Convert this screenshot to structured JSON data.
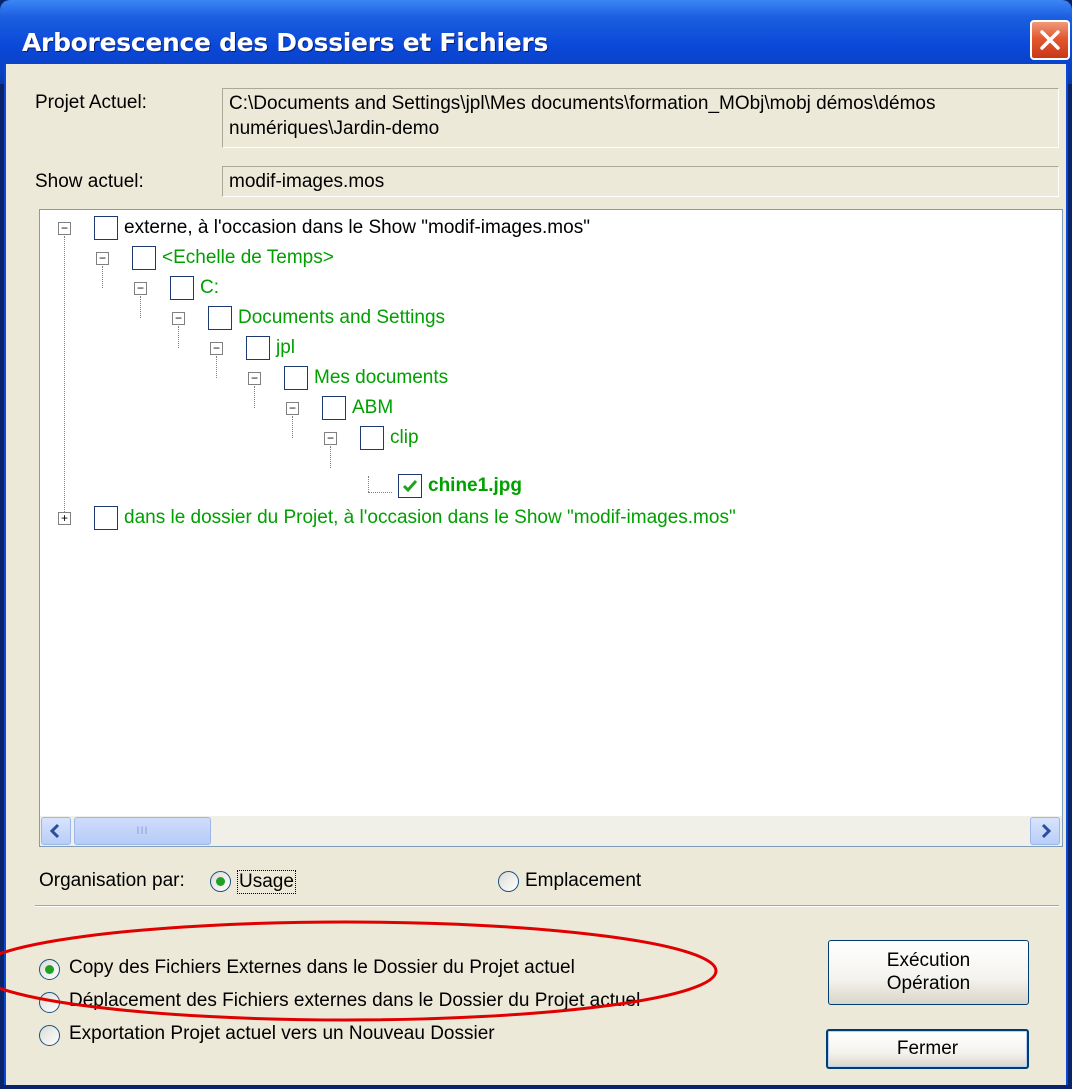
{
  "window": {
    "title": "Arborescence des Dossiers et Fichiers",
    "close_label": "close"
  },
  "project": {
    "label": "Projet Actuel:",
    "path_line1": "C:\\Documents and Settings\\jpl\\Mes documents\\formation_MObj\\mobj démos\\démos",
    "path_line2": "numériques\\Jardin-demo"
  },
  "show": {
    "label": "Show actuel:",
    "value": "modif-images.mos"
  },
  "tree": {
    "nodes": [
      {
        "text": "externe, à l'occasion dans le Show \"modif-images.mos\"",
        "level": 0,
        "expander": "−",
        "checked": false,
        "color": "black",
        "bold": false
      },
      {
        "text": "<Echelle de Temps>",
        "level": 1,
        "expander": "−",
        "checked": false,
        "color": "green",
        "bold": false
      },
      {
        "text": "C:",
        "level": 2,
        "expander": "−",
        "checked": false,
        "color": "green",
        "bold": false
      },
      {
        "text": "Documents and Settings",
        "level": 3,
        "expander": "−",
        "checked": false,
        "color": "green",
        "bold": false
      },
      {
        "text": "jpl",
        "level": 4,
        "expander": "−",
        "checked": false,
        "color": "green",
        "bold": false
      },
      {
        "text": "Mes documents",
        "level": 5,
        "expander": "−",
        "checked": false,
        "color": "green",
        "bold": false
      },
      {
        "text": "ABM",
        "level": 6,
        "expander": "−",
        "checked": false,
        "color": "green",
        "bold": false
      },
      {
        "text": "clip",
        "level": 7,
        "expander": "−",
        "checked": false,
        "color": "green",
        "bold": false
      },
      {
        "text": "chine1.jpg",
        "level": 8,
        "expander": "",
        "checked": true,
        "color": "green",
        "bold": true
      },
      {
        "text": "dans le dossier du Projet, à l'occasion dans le Show \"modif-images.mos\"",
        "level": 0,
        "expander": "+",
        "checked": false,
        "color": "green",
        "bold": false
      }
    ],
    "scroll_thumb_text": "III"
  },
  "organisation": {
    "label": "Organisation par:",
    "options": [
      {
        "label": "Usage",
        "selected": true
      },
      {
        "label": "Emplacement",
        "selected": false
      }
    ]
  },
  "operations": {
    "options": [
      {
        "label": "Copy des Fichiers Externes dans le Dossier du Projet actuel",
        "selected": true
      },
      {
        "label": "Déplacement des Fichiers externes dans le Dossier du Projet actuel",
        "selected": false
      },
      {
        "label": "Exportation Projet actuel vers un Nouveau Dossier",
        "selected": false
      }
    ]
  },
  "buttons": {
    "execute_line1": "Exécution",
    "execute_line2": "Opération",
    "close": "Fermer"
  },
  "colors": {
    "tree_green": "#00a000",
    "annotation_ellipse": "#e00000"
  }
}
